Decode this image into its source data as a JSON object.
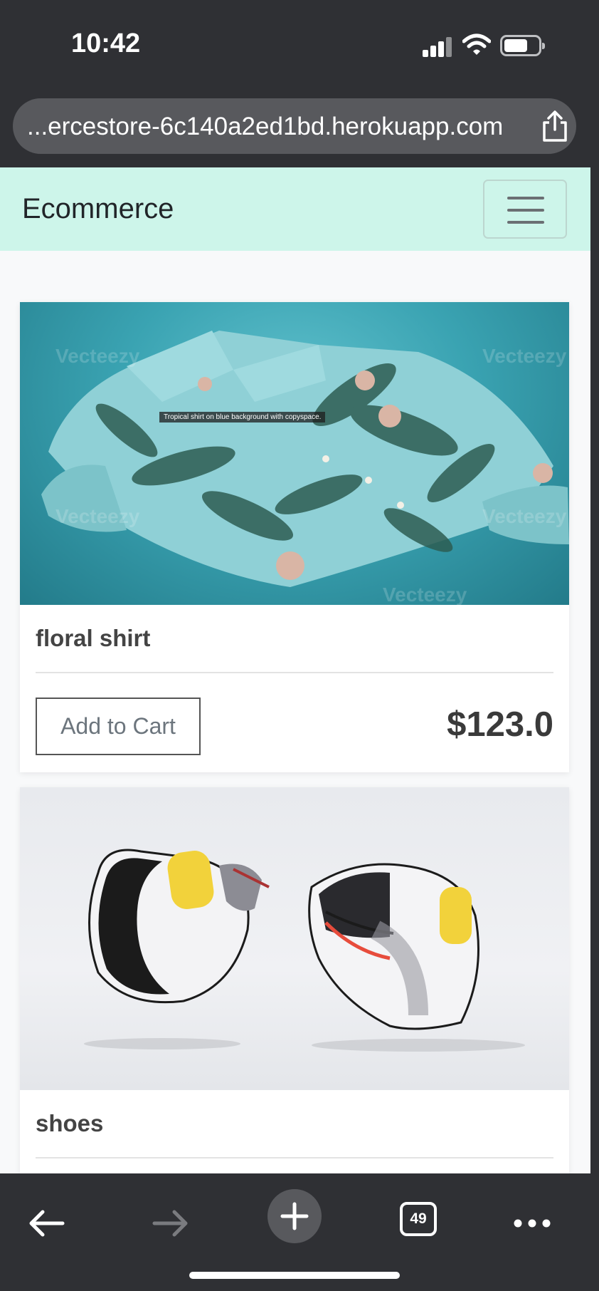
{
  "status_bar": {
    "time": "10:42"
  },
  "browser": {
    "url": "...ercestore-6c140a2ed1bd.herokuapp.com",
    "tab_count": "49"
  },
  "navbar": {
    "brand": "Ecommerce"
  },
  "products": [
    {
      "name": "floral shirt",
      "price": "$123.0",
      "button_label": "Add to Cart",
      "image_caption": "Tropical shirt on blue background with copyspace.",
      "watermark": "Vecteezy"
    },
    {
      "name": "shoes"
    }
  ],
  "colors": {
    "navbar_bg": "#cdf5ea",
    "browser_chrome": "#2f3034"
  }
}
